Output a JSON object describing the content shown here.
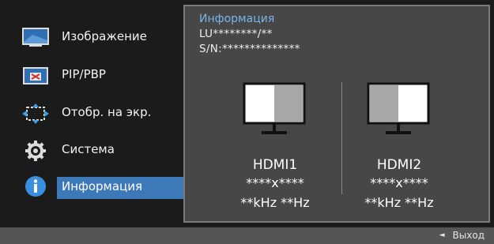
{
  "menu": {
    "items": [
      {
        "label": "Изображение",
        "icon": "picture-icon",
        "active": false
      },
      {
        "label": "PIP/PBP",
        "icon": "pip-pbp-icon",
        "active": false
      },
      {
        "label": "Отобр. на экр.",
        "icon": "onscreen-display-icon",
        "active": false
      },
      {
        "label": "Система",
        "icon": "gear-icon",
        "active": false
      },
      {
        "label": "Информация",
        "icon": "info-icon",
        "active": true
      }
    ]
  },
  "info": {
    "title": "Информация",
    "model": "LU********/**",
    "serial": "S/N:**************",
    "ports": [
      {
        "name": "HDMI1",
        "resolution": "****x****",
        "frequency": "**kHz **Hz",
        "highlight": "right"
      },
      {
        "name": "HDMI2",
        "resolution": "****x****",
        "frequency": "**kHz **Hz",
        "highlight": "left"
      }
    ]
  },
  "footer": {
    "exit_label": "Выход",
    "exit_icon": "left-arrow-icon"
  },
  "colors": {
    "accent": "#3d78b8",
    "title": "#7ab3e9",
    "panel": "#474747",
    "background": "#1b1b1b",
    "footer": "#555555"
  }
}
